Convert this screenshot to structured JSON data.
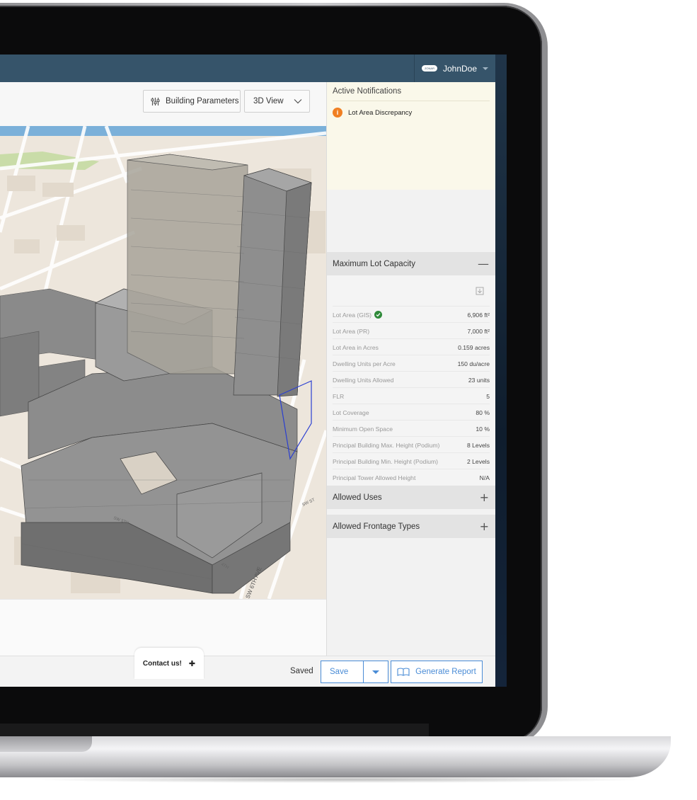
{
  "header": {
    "user_name": "JohnDoe",
    "user_logo_text": "ZONAR"
  },
  "toolbar": {
    "building_parameters_label": "Building Parameters",
    "view_select_value": "3D View"
  },
  "map": {
    "street_labels": [
      "SW 6TH AVE",
      "SW ST",
      "4TH",
      "SW 5TH"
    ]
  },
  "notifications": {
    "title": "Active Notifications",
    "items": [
      {
        "icon": "info-icon",
        "text": "Lot Area Discrepancy"
      }
    ]
  },
  "capacity": {
    "title": "Maximum Lot Capacity",
    "toggle_symbol": "—",
    "rows": [
      {
        "label": "Lot Area (GIS)",
        "value": "6,906 ft²",
        "verified": true
      },
      {
        "label": "Lot Area (PR)",
        "value": "7,000 ft²"
      },
      {
        "label": "Lot Area in Acres",
        "value": "0.159 acres"
      },
      {
        "label": "Dwelling Units per Acre",
        "value": "150 du/acre"
      },
      {
        "label": "Dwelling Units Allowed",
        "value": "23 units"
      },
      {
        "label": "FLR",
        "value": "5"
      },
      {
        "label": "Lot Coverage",
        "value": "80 %"
      },
      {
        "label": "Minimum Open Space",
        "value": "10 %"
      },
      {
        "label": "Principal Building Max. Height (Podium)",
        "value": "8 Levels"
      },
      {
        "label": "Principal Building Min. Height (Podium)",
        "value": "2 Levels"
      },
      {
        "label": "Principal Tower Allowed Height",
        "value": "N/A"
      }
    ]
  },
  "allowed_uses": {
    "title": "Allowed Uses",
    "toggle_symbol": "+"
  },
  "frontage_types": {
    "title": "Allowed Frontage Types",
    "toggle_symbol": "+"
  },
  "footer": {
    "contact_label": "Contact us!",
    "contact_symbol": "✚",
    "status": "Saved",
    "save_label": "Save",
    "report_label": "Generate Report"
  },
  "colors": {
    "topbar": "#36546a",
    "accent": "#4a8cd6",
    "warning": "#f07f22",
    "verified": "#2f8a3a"
  }
}
